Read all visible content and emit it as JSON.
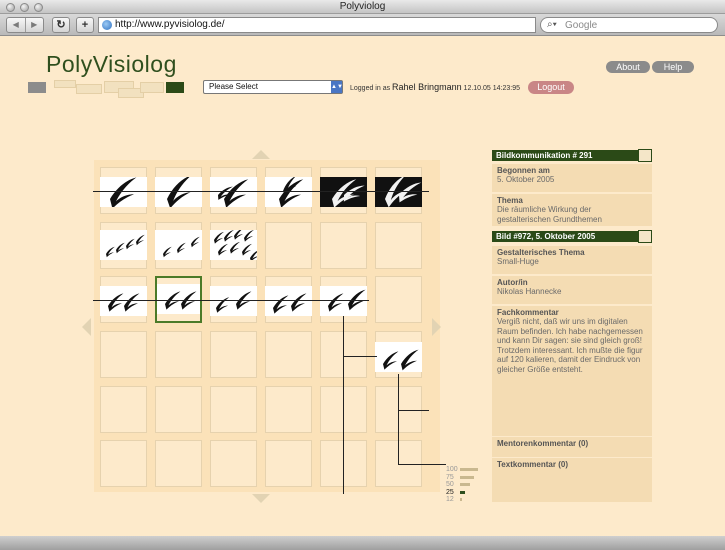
{
  "window": {
    "title": "Polyviolog"
  },
  "browser": {
    "url": "http://www.pyvisiolog.de/",
    "search_placeholder": "Google",
    "add_label": "+",
    "reload_label": "C"
  },
  "site": {
    "logo": "PolyVisiolog",
    "select_value": "Please Select",
    "logged_prefix": "Logged in as",
    "user": "Rahel Bringmann",
    "login_time": "12.10.05 14:23:95",
    "logout": "Logout",
    "about": "About",
    "help": "Help"
  },
  "zoom": {
    "levels": [
      "100",
      "75",
      "50",
      "25",
      "12"
    ],
    "current": "25"
  },
  "panel": {
    "header1": "Bildkommunikation # 291",
    "begun_label": "Begonnen am",
    "begun_value": "5. Oktober 2005",
    "theme_label": "Thema",
    "theme_value": "Die räumliche Wirkung der gestalterischen Grundthemen",
    "header2": "Bild #972, 5. Oktober 2005",
    "design_theme_label": "Gestalterisches Thema",
    "design_theme_value": "Small-Huge",
    "author_label": "Autor/in",
    "author_value": "Nikolas Hannecke",
    "comment_label": "Fachkommentar",
    "comment_value": "Vergiß nicht, daß wir uns im digitalen Raum befinden. Ich habe nachgemessen und kann Dir sagen: sie sind gleich groß! Trotzdem interessant. Ich mußte die figur auf 120 kalieren, damit der Eindruck von gleicher Größe entsteht.",
    "mentor_label": "Mentorenkommentar (0)",
    "text_label": "Textkommentar (0)"
  },
  "colors": {
    "brand_green": "#2b4a17",
    "background": "#fdeacb",
    "logout": "#c98686"
  }
}
